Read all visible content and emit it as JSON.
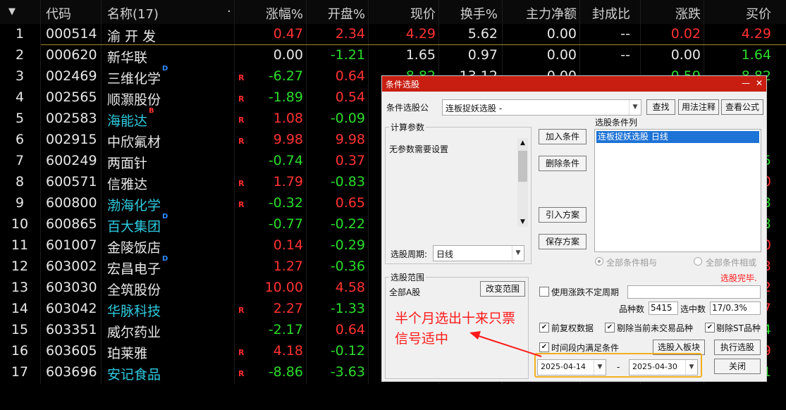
{
  "table": {
    "headers": {
      "sort": "▼",
      "code": "代码",
      "name": "名称(17)",
      "dot": "·",
      "chg": "涨幅%",
      "open": "开盘%",
      "price": "现价",
      "turn": "换手%",
      "flow": "主力净额",
      "seal": "封成比",
      "diff": "涨跌",
      "bid": "买价"
    },
    "rows": [
      {
        "idx": "1",
        "code": "000514",
        "name": "渝 开 发",
        "chg": "0.47",
        "open": "2.34",
        "price": "4.29",
        "turn": "5.62",
        "flow": "0.00",
        "seal": "--",
        "diff": "0.02",
        "bid": "4.29"
      },
      {
        "idx": "2",
        "code": "000620",
        "name": "新华联",
        "chg": "0.00",
        "open": "-1.21",
        "price": "1.65",
        "turn": "0.97",
        "flow": "0.00",
        "seal": "--",
        "diff": "0.00",
        "bid": "1.64"
      },
      {
        "idx": "3",
        "code": "002469",
        "name": "三维化学",
        "sup": "D",
        "r": "R",
        "chg": "-6.27",
        "open": "0.64",
        "price": "8.82",
        "turn": "13.12",
        "flow": "0.00",
        "seal": "--",
        "diff": "-0.59",
        "bid": "8.82"
      },
      {
        "idx": "4",
        "code": "002565",
        "name": "顺灏股份",
        "r": "R",
        "chg": "-1.89",
        "open": "0.54"
      },
      {
        "idx": "5",
        "code": "002583",
        "name": "海能达",
        "cyan": true,
        "sup": "B",
        "r": "R",
        "chg": "1.08",
        "open": "-0.09"
      },
      {
        "idx": "6",
        "code": "002915",
        "name": "中欣氟材",
        "r": "R",
        "chg": "9.98",
        "open": "9.98"
      },
      {
        "idx": "7",
        "code": "600249",
        "name": "两面针",
        "chg": "-0.74",
        "open": "0.37",
        "bid": "5"
      },
      {
        "idx": "8",
        "code": "600571",
        "name": "信雅达",
        "r": "R",
        "chg": "1.79",
        "open": "-0.83",
        "bid": "0"
      },
      {
        "idx": "9",
        "code": "600800",
        "name": "渤海化学",
        "cyan": true,
        "r": "R",
        "chg": "-0.32",
        "open": "0.65",
        "bid": "3"
      },
      {
        "idx": "10",
        "code": "600865",
        "name": "百大集团",
        "cyan": true,
        "sup": "D",
        "chg": "-0.77",
        "open": "-0.22",
        "bid": "3"
      },
      {
        "idx": "11",
        "code": "601007",
        "name": "金陵饭店",
        "chg": "0.14",
        "open": "-0.29",
        "bid": "0"
      },
      {
        "idx": "12",
        "code": "603002",
        "name": "宏昌电子",
        "sup": "D",
        "chg": "1.27",
        "open": "-0.36",
        "bid": "3"
      },
      {
        "idx": "13",
        "code": "603030",
        "name": "全筑股份",
        "chg": "10.00",
        "open": "4.58",
        "bid": "2"
      },
      {
        "idx": "14",
        "code": "603042",
        "name": "华脉科技",
        "cyan": true,
        "r": "R",
        "chg": "2.27",
        "open": "-1.33",
        "bid": "7"
      },
      {
        "idx": "15",
        "code": "603351",
        "name": "威尔药业",
        "chg": "-2.17",
        "open": "0.64",
        "bid": "4"
      },
      {
        "idx": "16",
        "code": "603605",
        "name": "珀莱雅",
        "r": "R",
        "chg": "4.18",
        "open": "-0.12",
        "bid": "9"
      },
      {
        "idx": "17",
        "code": "603696",
        "name": "安记食品",
        "cyan": true,
        "r": "R",
        "chg": "-8.86",
        "open": "-3.63",
        "bid": "1"
      }
    ]
  },
  "dialog": {
    "title": "条件选股",
    "minimize": "—",
    "close": "✕",
    "formula_label": "条件选股公",
    "formula_value": "连板捉妖选股  -",
    "find_btn": "查找",
    "usage_btn": "用法注释",
    "view_btn": "查看公式",
    "params_group": "计算参数",
    "params_text": "无参数需要设置",
    "period_label": "选股周期:",
    "period_value": "日线",
    "add_btn": "加入条件",
    "delete_btn": "删除条件",
    "import_btn": "引入方案",
    "save_btn": "保存方案",
    "conditions_label": "选股条件列",
    "conditions": [
      "连板捉妖选股  日线"
    ],
    "and_label": "全部条件相与",
    "or_label": "全部条件相或",
    "done_text": "选股完毕.",
    "range_group": "选股范围",
    "range_value": "全部A股",
    "change_range_btn": "改变范围",
    "uncertain_period_label": "使用涨跌不定周期",
    "total_label": "品种数",
    "total_value": "5415",
    "selected_label": "选中数",
    "selected_value": "17/0.3%",
    "pre_adjust_label": "前复权数据",
    "exclude_untraded_label": "剔除当前未交易品种",
    "exclude_st_label": "剔除ST品种",
    "time_range_label": "时间段内满足条件",
    "to_block_btn": "选股入板块",
    "execute_btn": "执行选股",
    "date_from": "2025-04-14",
    "date_sep": "-",
    "date_to": "2025-04-30",
    "close_btn": "关闭"
  },
  "annotation": {
    "line1": "半个月选出十来只票",
    "line2": "信号适中",
    "color": "#ff1a1a",
    "box_color": "#f2b01e"
  },
  "colors": {
    "up": "#ff3232",
    "down": "#2bdc2b",
    "flat": "#e8e8e8",
    "cyan_name": "#2ecbe0",
    "title_bar": "#c81e12"
  }
}
